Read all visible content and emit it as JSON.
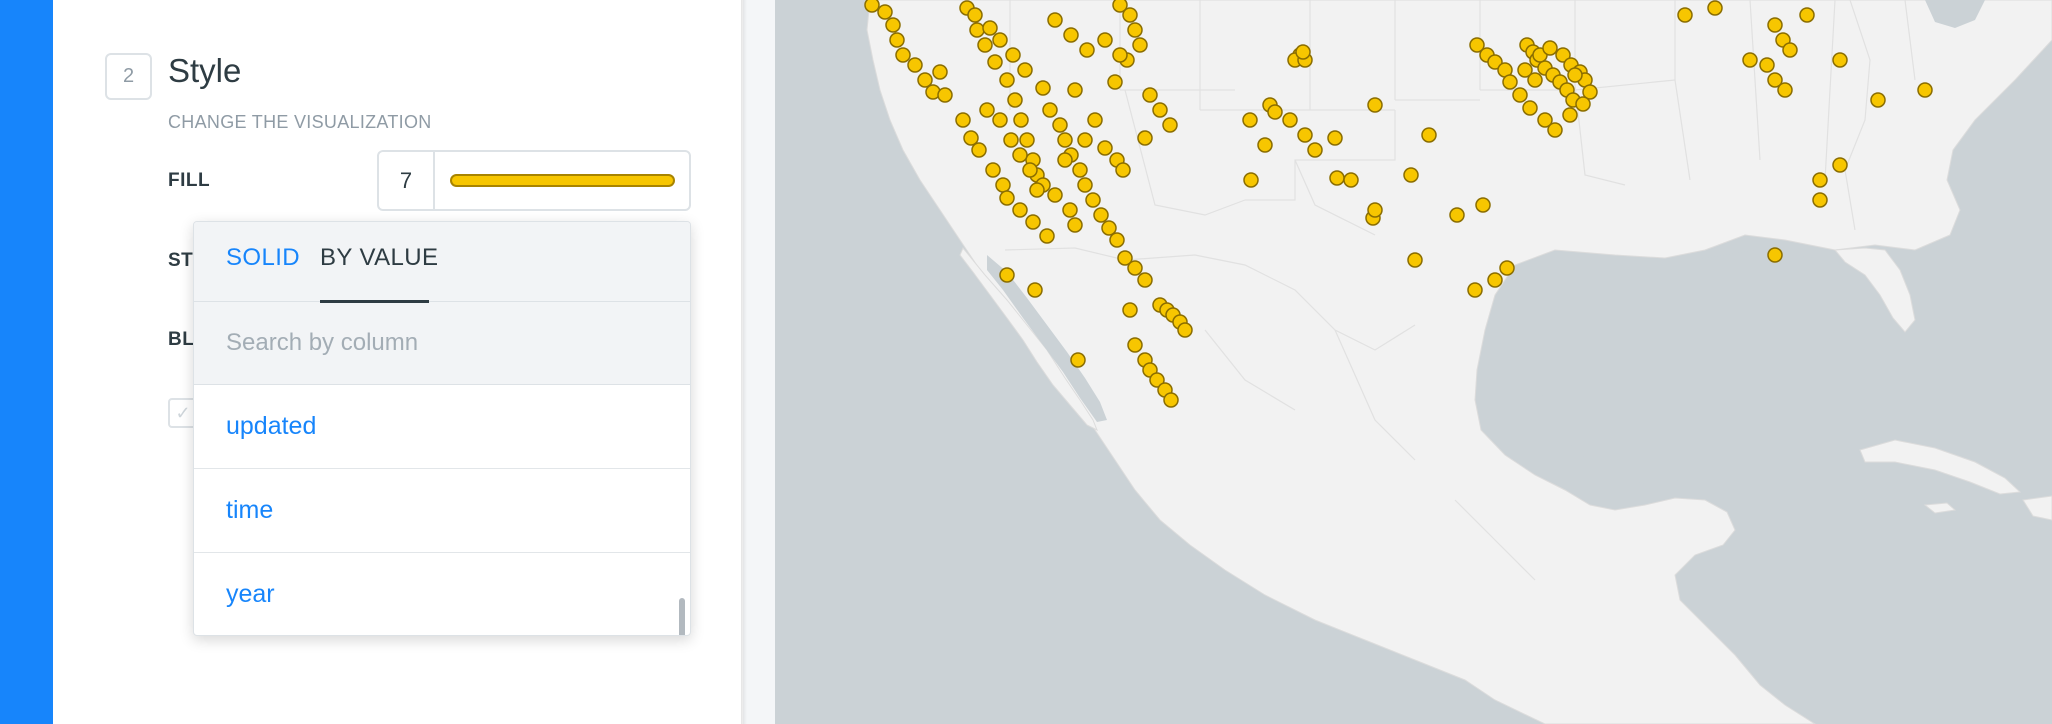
{
  "panel": {
    "step_number": "2",
    "section_title": "Style",
    "section_subtitle": "CHANGE THE VISUALIZATION",
    "fill": {
      "label": "FILL",
      "size_value": "7",
      "color": "#f7c600"
    },
    "partial_labels": [
      "ST",
      "BL"
    ],
    "dropdown": {
      "tabs": [
        {
          "label": "SOLID",
          "active": false
        },
        {
          "label": "BY VALUE",
          "active": true
        }
      ],
      "search_placeholder": "Search by column",
      "items": [
        "updated",
        "time",
        "year"
      ]
    }
  },
  "map": {
    "point_color": "#f7c600",
    "point_stroke": "#8a6d00",
    "land_color": "#f2f2f2",
    "water_color": "#cbd2d6"
  }
}
